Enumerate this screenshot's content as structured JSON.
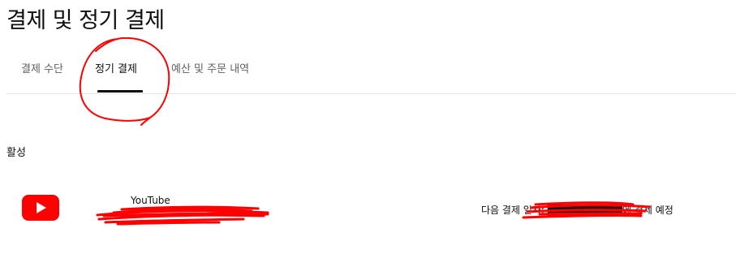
{
  "page_title": "결제 및 정기 결제",
  "tabs": [
    {
      "label": "결제 수단",
      "active": false
    },
    {
      "label": "정기 결제",
      "active": true
    },
    {
      "label": "예산 및 주문 내역",
      "active": false
    }
  ],
  "section": {
    "heading": "활성"
  },
  "subscription": {
    "icon": "youtube-logo-icon",
    "name": "YouTube",
    "billing_text": "다음 결제 일자: ██████████에 결제 예정"
  },
  "colors": {
    "brand_red": "#ff0000",
    "annotation_red": "#ff0000",
    "tab_inactive": "#606060",
    "text": "#0f0f0f"
  }
}
